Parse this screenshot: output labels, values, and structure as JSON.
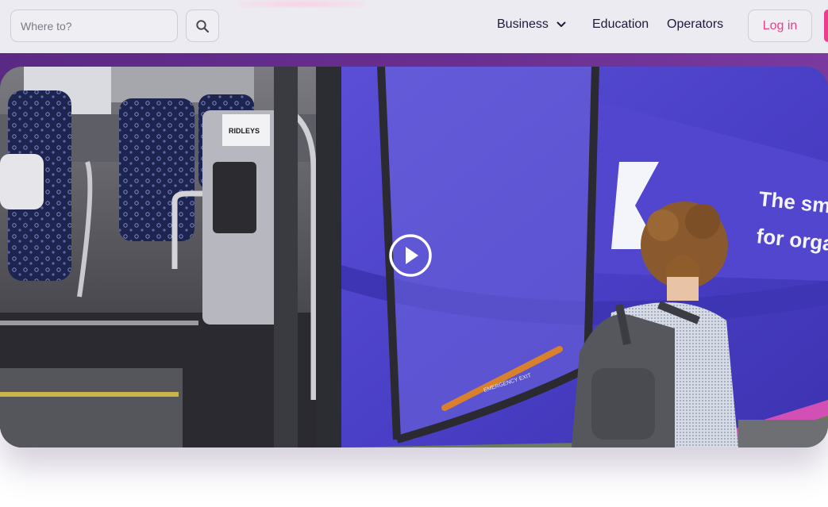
{
  "header": {
    "search": {
      "placeholder": "Where to?",
      "value": "",
      "icon": "search-icon"
    },
    "nav": {
      "business_label": "Business",
      "business_icon": "chevron-down-icon",
      "education_label": "Education",
      "operators_label": "Operators"
    },
    "login_label": "Log in"
  },
  "video": {
    "play_icon": "play-icon",
    "bus_text_line1": "The smart bus s",
    "bus_text_line2": "for organisatio",
    "door_sign": "RIDLEYS",
    "emergency_label": "EMERGENCY EXIT"
  },
  "colors": {
    "accent": "#ec3d8d",
    "nav_bg": "#ecebf1",
    "band": "#5b2a86",
    "bus_body": "#4a3fc7",
    "nav_text": "#1d1b3a"
  }
}
